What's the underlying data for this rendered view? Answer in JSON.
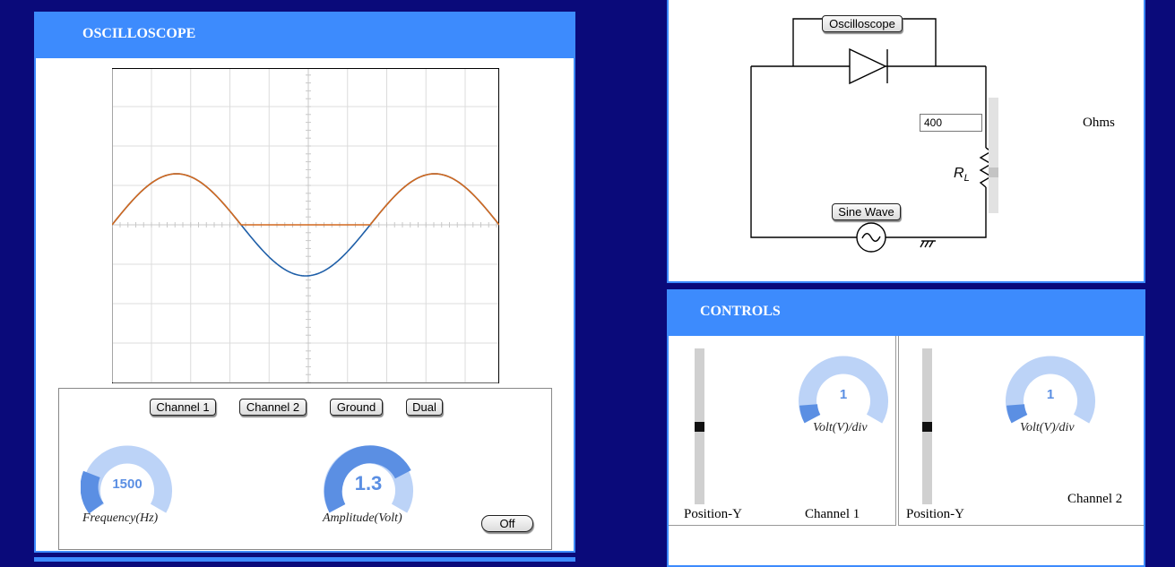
{
  "oscilloscope": {
    "title": "OSCILLOSCOPE",
    "buttons": {
      "channel1": "Channel 1",
      "channel2": "Channel 2",
      "ground": "Ground",
      "dual": "Dual",
      "off": "Off"
    },
    "frequency": {
      "value": "1500",
      "label": "Frequency(Hz)"
    },
    "amplitude": {
      "value": "1.3",
      "label": "Amplitude(Volt)"
    }
  },
  "circuit": {
    "oscilloscope_button": "Oscilloscope",
    "sine_wave_button": "Sine Wave",
    "resistance_value": "400",
    "resistance_unit": "Ohms",
    "resistor_label": "R",
    "resistor_subscript": "L"
  },
  "controls": {
    "title": "CONTROLS",
    "channel1": {
      "volt_value": "1",
      "volt_label": "Volt(V)/div",
      "position_label": "Position-Y",
      "name": "Channel 1"
    },
    "channel2": {
      "volt_value": "1",
      "volt_label": "Volt(V)/div",
      "position_label": "Position-Y",
      "name": "Channel 2"
    }
  },
  "colors": {
    "accent": "#3d8bfd",
    "trace1": "#1f5fa8",
    "trace2": "#d2691e",
    "background": "#0a0a7a"
  }
}
